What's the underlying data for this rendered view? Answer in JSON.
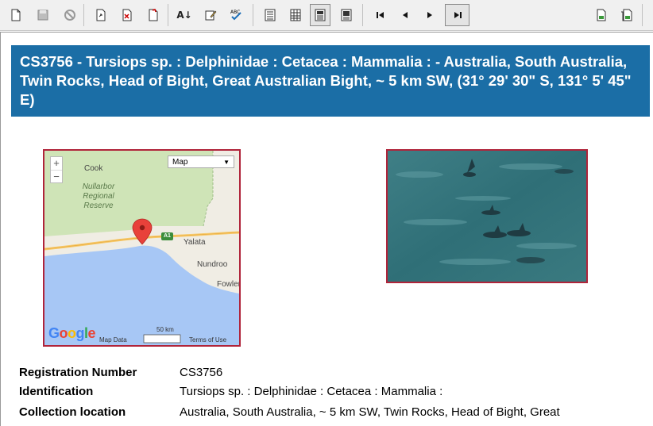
{
  "toolbar": {
    "buttons": [
      {
        "icon": "new-document-icon",
        "glyph": "🗋"
      },
      {
        "icon": "save-icon",
        "glyph": "💾"
      },
      {
        "icon": "cancel-icon",
        "glyph": "⊘"
      },
      {
        "icon": "record-export-icon",
        "glyph": "⎘"
      },
      {
        "icon": "record-delete-icon",
        "glyph": "⎘"
      },
      {
        "icon": "record-new-icon",
        "glyph": "⎘"
      },
      {
        "icon": "sort-az-icon",
        "glyph": "A↓"
      },
      {
        "icon": "edit-icon",
        "glyph": "✎"
      },
      {
        "icon": "spellcheck-icon",
        "glyph": "ᴬᴮᶜ"
      },
      {
        "icon": "view-list-icon",
        "glyph": "☰"
      },
      {
        "icon": "view-grid-icon",
        "glyph": "▦"
      },
      {
        "icon": "view-detail-icon",
        "glyph": "▤"
      },
      {
        "icon": "view-image-icon",
        "glyph": "▣"
      },
      {
        "icon": "first-record-icon",
        "glyph": "⏮"
      },
      {
        "icon": "prev-record-icon",
        "glyph": "◀"
      },
      {
        "icon": "next-record-icon",
        "glyph": "▶"
      },
      {
        "icon": "last-record-icon",
        "glyph": "⏭"
      },
      {
        "icon": "print-page-icon",
        "glyph": "▤"
      },
      {
        "icon": "print-all-icon",
        "glyph": "▤"
      }
    ]
  },
  "record": {
    "title": "CS3756 - Tursiops sp. : Delphinidae : Cetacea : Mammalia : - Australia, South Australia, Twin Rocks, Head of Bight, Great Australian Bight, ~ 5 km SW, (31° 29' 30\" S, 131° 5' 45\" E)"
  },
  "map": {
    "type_label": "Map",
    "zoom_in": "+",
    "zoom_out": "−",
    "places": [
      "Cook",
      "Nullarbor Regional Reserve",
      "Yalata",
      "Nundroo",
      "Fowler"
    ],
    "reserve_lines": [
      "Nullarbor",
      "Regional",
      "Reserve"
    ],
    "road_badge": "A1",
    "logo": "Google",
    "map_data": "Map Data",
    "scale": "50 km",
    "terms": "Terms of Use"
  },
  "details": {
    "registration_label": "Registration Number",
    "registration_value": "CS3756",
    "identification_label": "Identification",
    "identification_value": "Tursiops sp. : Delphinidae : Cetacea : Mammalia :",
    "collection_label": "Collection location",
    "collection_value": "Australia, South Australia, ~ 5 km SW, Twin Rocks, Head of Bight, Great"
  },
  "colors": {
    "title_band": "#1b6ea6",
    "frame_border": "#b0243a",
    "land": "#cfe4b7",
    "sea": "#a7c7f5"
  }
}
